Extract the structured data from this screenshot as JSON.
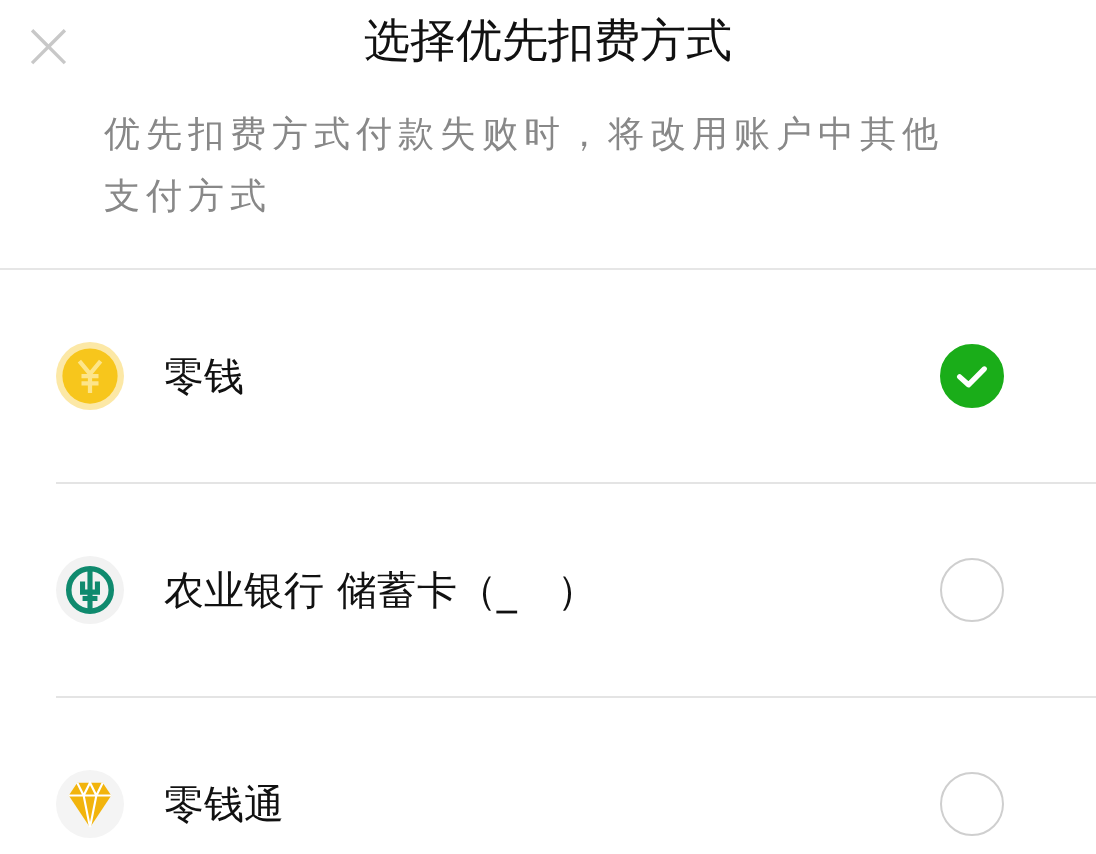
{
  "header": {
    "close": "×",
    "title": "选择优先扣费方式"
  },
  "note": "优先扣费方式付款失败时，将改用账户中其他支付方式",
  "options": [
    {
      "kind": "coin",
      "label": "零钱",
      "selected": true
    },
    {
      "kind": "bank",
      "label": "农业银行 储蓄卡（_　）",
      "selected": false
    },
    {
      "kind": "diamond",
      "label": "零钱通",
      "selected": false
    }
  ]
}
